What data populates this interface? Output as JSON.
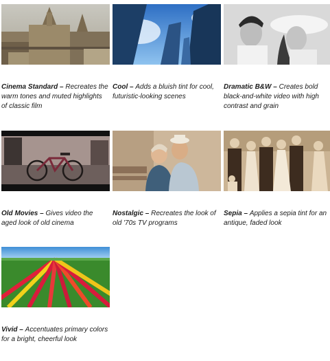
{
  "effects": [
    {
      "name": "Cinema Standard",
      "sep": " – ",
      "desc": "Recreates the warm tones and muted highlights of classic film",
      "image": "cathedral-city-photo"
    },
    {
      "name": "Cool",
      "sep": " – ",
      "desc": "Adds a bluish tint for cool, futuristic-looking scenes",
      "image": "skyscrapers-photo"
    },
    {
      "name": "Dramatic B&W",
      "sep": " – ",
      "desc": "Creates bold black-and-white video with high contrast and grain",
      "image": "couple-portrait-photo"
    },
    {
      "name": "Old Movies",
      "sep": " – ",
      "desc": "Gives video the aged look of old cinema",
      "image": "bicycle-photo"
    },
    {
      "name": "Nostalgic",
      "sep": " – ",
      "desc": "Recreates the look of old '70s TV programs",
      "image": "elderly-couple-photo"
    },
    {
      "name": "Sepia",
      "sep": " – ",
      "desc": "Applies a sepia tint for an antique, faded look",
      "image": "wedding-party-photo"
    },
    {
      "name": "Vivid",
      "sep": " – ",
      "desc": "Accentuates primary colors for a bright, cheerful look",
      "image": "tulip-field-photo"
    }
  ]
}
